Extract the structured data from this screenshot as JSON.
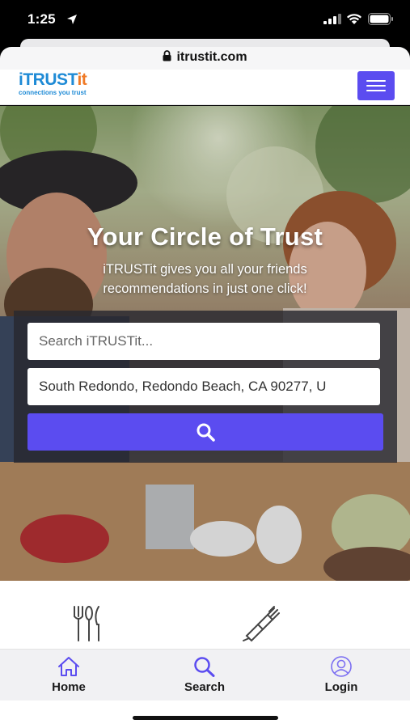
{
  "status_bar": {
    "time": "1:25"
  },
  "browser": {
    "url": "itrustit.com"
  },
  "header": {
    "logo_i": "i",
    "logo_trust": "TRUST",
    "logo_it": "it",
    "logo_tagline": "connections you trust",
    "menu_icon": "hamburger-menu-icon"
  },
  "hero": {
    "title": "Your Circle of Trust",
    "subtitle": "iTRUSTit gives you all your friends recommendations in just one click!"
  },
  "search": {
    "query_placeholder": "Search iTRUSTit...",
    "location_value": "South Redondo, Redondo Beach, CA 90277, U",
    "button_icon": "search-icon"
  },
  "categories": [
    {
      "icon": "fork-knife-icon"
    },
    {
      "icon": "paint-brush-icon"
    }
  ],
  "bottom_nav": [
    {
      "label": "Home",
      "icon": "home-icon"
    },
    {
      "label": "Search",
      "icon": "search-icon"
    },
    {
      "label": "Login",
      "icon": "user-circle-icon"
    }
  ],
  "colors": {
    "accent": "#5b4cf0",
    "logo_blue": "#1f8bd6",
    "logo_orange": "#f07a26"
  }
}
